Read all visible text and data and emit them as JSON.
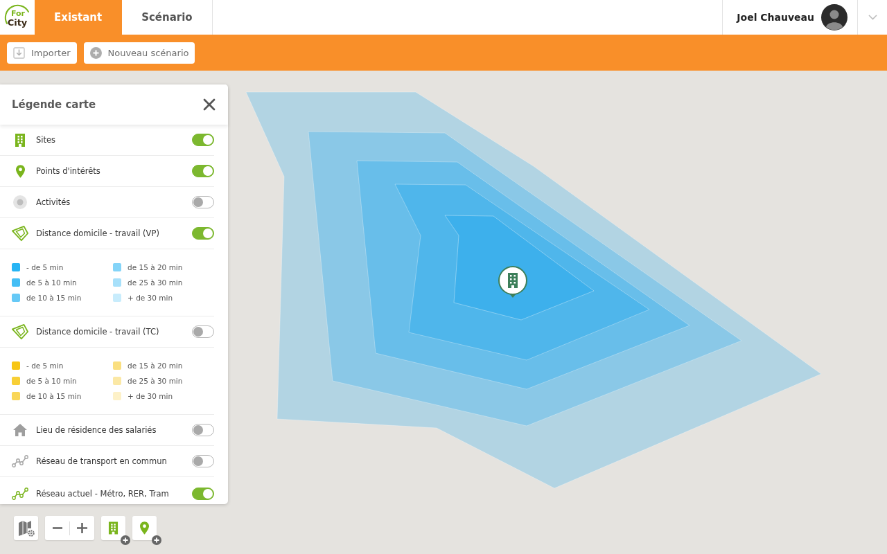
{
  "header": {
    "logo": {
      "line_1": "For",
      "line_2": "City"
    },
    "tabs": [
      {
        "label": "Existant",
        "selected": true
      },
      {
        "label": "Scénario",
        "selected": false
      }
    ],
    "user": {
      "name": "Joel Chauveau"
    }
  },
  "toolbar": {
    "buttons": [
      {
        "kind": "import",
        "label": "Importer"
      },
      {
        "kind": "create",
        "label": "Nouveau scénario"
      }
    ]
  },
  "legend": {
    "title": "Légende carte",
    "items": [
      {
        "kind": "layer",
        "label": "Sites",
        "on": true
      },
      {
        "kind": "layer",
        "label": "Points d'intérêts",
        "on": true
      },
      {
        "kind": "layer",
        "label": "Activités",
        "on": false
      },
      {
        "kind": "layer",
        "label": "Distance domicile - travail (VP)",
        "on": true
      },
      {
        "kind": "scale",
        "entries": [
          {
            "label": "- de 5 min",
            "color": "#27b4f4"
          },
          {
            "label": "de 5 à 10 min",
            "color": "#44bef5"
          },
          {
            "label": "de 10 à 15 min",
            "color": "#66c9f6"
          },
          {
            "label": "de 15 à 20 min",
            "color": "#84d4f8"
          },
          {
            "label": "de 25 à 30 min",
            "color": "#a7e0fa"
          },
          {
            "label": "+ de 30 min",
            "color": "#c8ecfc"
          }
        ]
      },
      {
        "kind": "layer",
        "label": "Distance domicile - travail (TC)",
        "on": false
      },
      {
        "kind": "scale",
        "entries": [
          {
            "label": "- de 5 min",
            "color": "#f7c614"
          },
          {
            "label": "de 5 à 10 min",
            "color": "#f8cf36"
          },
          {
            "label": "de 10 à 15 min",
            "color": "#f9d658"
          },
          {
            "label": "de 15 à 20 min",
            "color": "#fadf80"
          },
          {
            "label": "de 25 à 30 min",
            "color": "#fbe8a5"
          },
          {
            "label": "+ de 30 min",
            "color": "#fdf1c8"
          }
        ]
      },
      {
        "kind": "layer",
        "label": "Lieu de résidence des salariés",
        "on": false
      },
      {
        "kind": "layer",
        "label": "Réseau de transport en commun",
        "on": false
      },
      {
        "kind": "layer",
        "label": "Réseau actuel - Métro, RER, Tram",
        "on": true
      }
    ]
  }
}
